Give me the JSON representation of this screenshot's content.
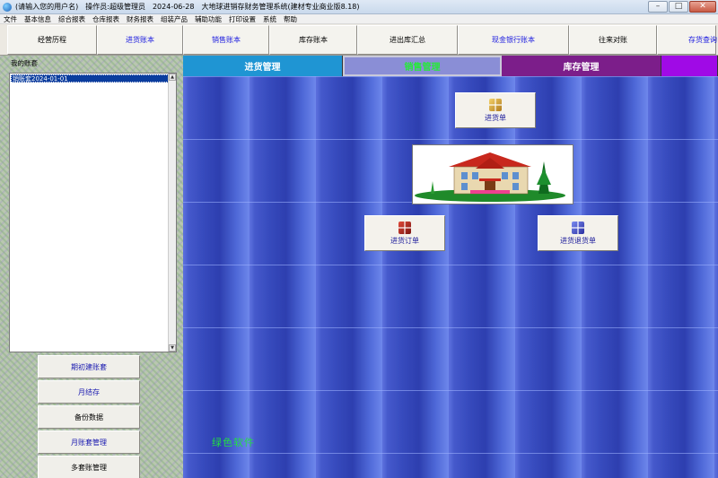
{
  "window": {
    "title_parts": [
      "(请输入您的用户名)",
      "操作员:超级管理员",
      "2024-06-28",
      "大地球进销存财务管理系统(建材专业商业版8.18)"
    ],
    "controls": {
      "minimize": "–",
      "maximize": "□",
      "close": "✕"
    }
  },
  "menu": [
    "文件",
    "基本信息",
    "综合报表",
    "仓库报表",
    "财务报表",
    "组装产品",
    "辅助功能",
    "打印设置",
    "系统",
    "帮助"
  ],
  "toolbar": [
    {
      "label": "经营历程",
      "blue": false
    },
    {
      "label": "进货账本",
      "blue": true
    },
    {
      "label": "销售账本",
      "blue": true
    },
    {
      "label": "库存账本",
      "blue": false
    },
    {
      "label": "进出库汇总",
      "blue": false
    },
    {
      "label": "现金银行账本",
      "blue": true
    },
    {
      "label": "往来对账",
      "blue": false
    },
    {
      "label": "存货查询",
      "blue": true
    }
  ],
  "left": {
    "mybooks_label": "我的账套",
    "selected_book": "销账套2024-01-01",
    "buttons": [
      {
        "label": "期初建账套",
        "blue": true
      },
      {
        "label": "月结存",
        "blue": true
      },
      {
        "label": "备份数据",
        "blue": false
      },
      {
        "label": "月账套管理",
        "blue": true
      },
      {
        "label": "多套账管理",
        "blue": false
      }
    ]
  },
  "tabs": [
    {
      "label": "进货管理"
    },
    {
      "label": "销售管理"
    },
    {
      "label": "库存管理"
    },
    {
      "label": ""
    }
  ],
  "functions": {
    "purchase_doc": "进货单",
    "purchase_order": "进货订单",
    "purchase_return": "进货退货单"
  },
  "brand": "绿色软件",
  "colors": {
    "tab_purchase": "#1f95d3",
    "tab_sales": "#8a8ed6",
    "tab_sales_text": "#27e83b",
    "tab_stock": "#7c1e8a",
    "tab_extra": "#a00ae6",
    "main_bg": "#3347b5",
    "brand_text": "#22dd44"
  }
}
